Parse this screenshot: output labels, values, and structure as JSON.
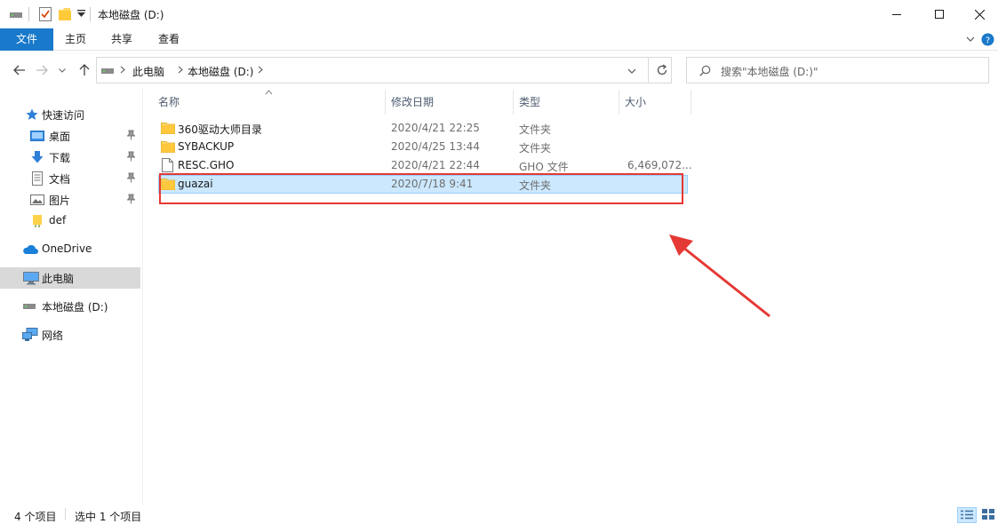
{
  "window": {
    "title": "本地磁盘 (D:)",
    "minimize_icon": "minimize-icon",
    "maximize_icon": "maximize-icon",
    "close_icon": "close-icon"
  },
  "ribbon": {
    "tabs": [
      "文件",
      "主页",
      "共享",
      "查看"
    ],
    "accent": "#1979ca"
  },
  "address": {
    "crumbs": [
      "此电脑",
      "本地磁盘 (D:)"
    ],
    "search_placeholder": "搜索\"本地磁盘 (D:)\""
  },
  "sidebar": {
    "items": [
      {
        "label": "快速访问",
        "icon": "star-icon",
        "pinned": false
      },
      {
        "label": "桌面",
        "icon": "desktop-icon",
        "pinned": true
      },
      {
        "label": "下载",
        "icon": "download-icon",
        "pinned": true
      },
      {
        "label": "文档",
        "icon": "documents-icon",
        "pinned": true
      },
      {
        "label": "图片",
        "icon": "pictures-icon",
        "pinned": true
      },
      {
        "label": "def",
        "icon": "folder-icon",
        "pinned": false
      },
      {
        "label": "OneDrive",
        "icon": "cloud-icon",
        "pinned": false
      },
      {
        "label": "此电脑",
        "icon": "computer-icon",
        "pinned": false,
        "selected": true
      },
      {
        "label": "本地磁盘 (D:)",
        "icon": "drive-icon",
        "pinned": false
      },
      {
        "label": "网络",
        "icon": "network-icon",
        "pinned": false
      }
    ]
  },
  "files": {
    "columns": [
      "名称",
      "修改日期",
      "类型",
      "大小"
    ],
    "rows": [
      {
        "name": "360驱动大师目录",
        "date": "2020/4/21 22:25",
        "type": "文件夹",
        "size": "",
        "icon": "folder-icon"
      },
      {
        "name": "SYBACKUP",
        "date": "2020/4/25 13:44",
        "type": "文件夹",
        "size": "",
        "icon": "folder-icon"
      },
      {
        "name": "RESC.GHO",
        "date": "2020/4/21 22:44",
        "type": "GHO 文件",
        "size": "6,469,072...",
        "icon": "file-icon"
      },
      {
        "name": "guazai",
        "date": "2020/7/18 9:41",
        "type": "文件夹",
        "size": "",
        "icon": "folder-icon",
        "selected": true
      }
    ]
  },
  "status": {
    "count": "4 个项目",
    "selected": "选中 1 个项目"
  },
  "annotation": {
    "color": "#e53935"
  }
}
